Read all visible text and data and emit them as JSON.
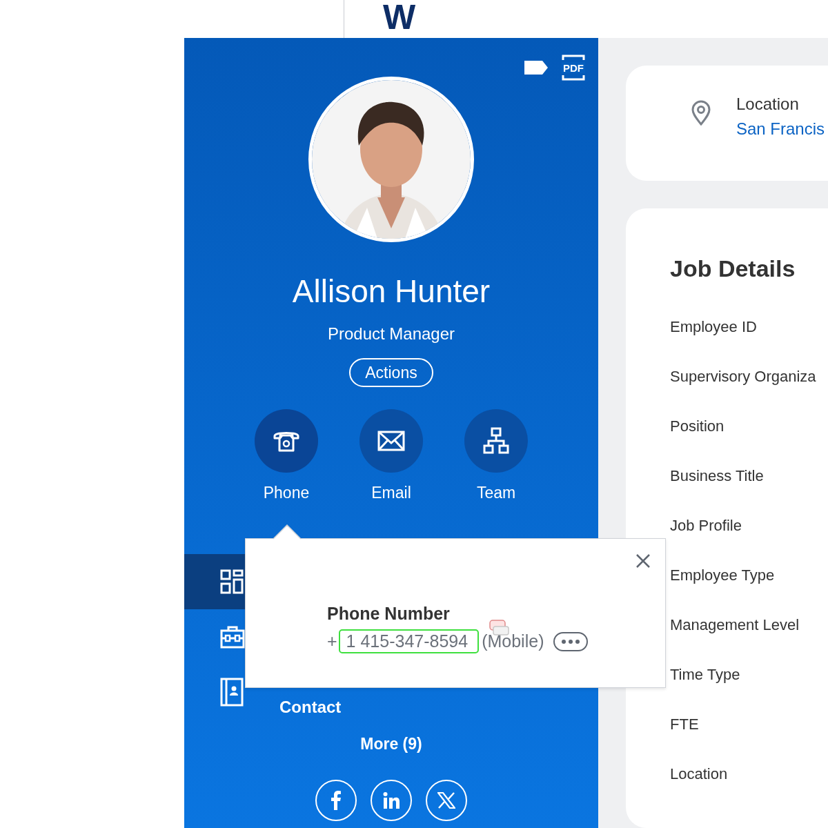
{
  "header": {
    "logo": "W"
  },
  "pdf_icon_label": "PDF",
  "profile": {
    "name": "Allison Hunter",
    "title": "Product Manager",
    "actions_button": "Actions"
  },
  "quick_actions": [
    {
      "kind": "phone",
      "label": "Phone",
      "selected": true
    },
    {
      "kind": "email",
      "label": "Email",
      "selected": false
    },
    {
      "kind": "team",
      "label": "Team",
      "selected": false
    }
  ],
  "nav": [
    {
      "kind": "summary",
      "selected": true
    },
    {
      "kind": "job",
      "selected": false
    },
    {
      "kind": "contact",
      "label": "Contact",
      "selected": false
    }
  ],
  "more_link": "More (9)",
  "social": [
    {
      "kind": "facebook"
    },
    {
      "kind": "linkedin"
    },
    {
      "kind": "x"
    }
  ],
  "phone_popup": {
    "heading": "Phone Number",
    "prefix": "+",
    "number": "1 415-347-8594",
    "type": "(Mobile)"
  },
  "location_card": {
    "label": "Location",
    "value": "San Francis"
  },
  "job_details": {
    "title": "Job Details",
    "fields": [
      "Employee ID",
      "Supervisory Organiza",
      "Position",
      "Business Title",
      "Job Profile",
      "Employee Type",
      "Management Level",
      "Time Type",
      "FTE",
      "Location"
    ]
  }
}
